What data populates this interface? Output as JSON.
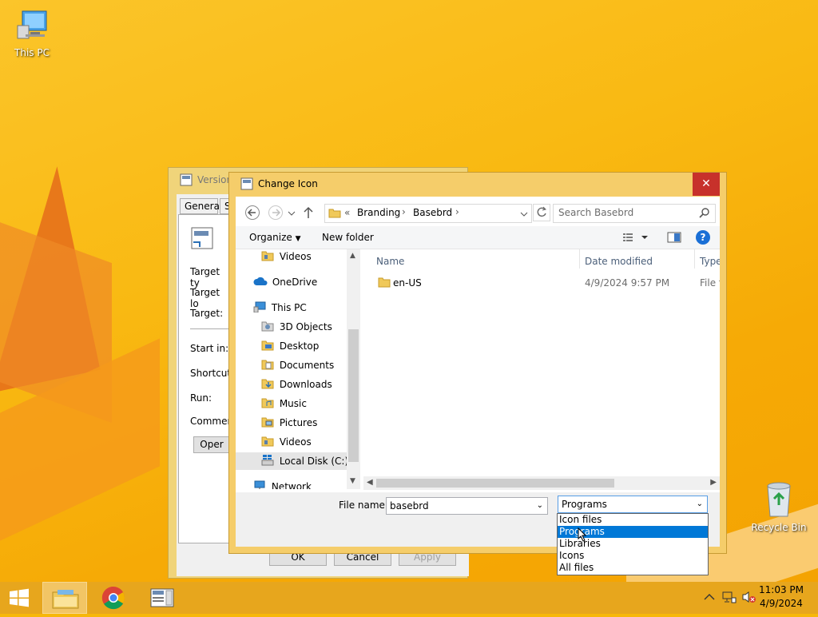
{
  "desktop": {
    "icons": [
      {
        "label": "This PC"
      },
      {
        "label": "Recycle Bin"
      }
    ]
  },
  "properties_window": {
    "title": "Version",
    "tabs": [
      "General",
      "S"
    ],
    "fields": [
      "Target ty",
      "Target lo",
      "Target:",
      "Start in:",
      "Shortcut",
      "Run:",
      "Commen"
    ],
    "open_button": "Oper",
    "ok": "OK",
    "cancel": "Cancel",
    "apply": "Apply"
  },
  "dialog": {
    "title": "Change Icon",
    "close_glyph": "✕",
    "breadcrumb": {
      "prefix": "«",
      "parts": [
        "Branding",
        "Basebrd"
      ]
    },
    "search_placeholder": "Search Basebrd",
    "toolbar": {
      "organize": "Organize",
      "new_folder": "New folder",
      "help": "?"
    },
    "nav_items": [
      {
        "label": "Videos",
        "icon": "video-folder"
      },
      {
        "label": "OneDrive",
        "icon": "cloud"
      },
      {
        "label": "This PC",
        "icon": "computer"
      },
      {
        "label": "3D Objects",
        "icon": "3d-folder"
      },
      {
        "label": "Desktop",
        "icon": "desktop-folder"
      },
      {
        "label": "Documents",
        "icon": "documents-folder"
      },
      {
        "label": "Downloads",
        "icon": "downloads-folder"
      },
      {
        "label": "Music",
        "icon": "music-folder"
      },
      {
        "label": "Pictures",
        "icon": "pictures-folder"
      },
      {
        "label": "Videos",
        "icon": "video-folder"
      },
      {
        "label": "Local Disk (C:)",
        "icon": "drive"
      },
      {
        "label": "Network",
        "icon": "network"
      }
    ],
    "columns": {
      "name": "Name",
      "date": "Date modified",
      "type": "Type"
    },
    "files": [
      {
        "name": "en-US",
        "date": "4/9/2024 9:57 PM",
        "type": "File fo"
      }
    ],
    "file_name_label": "File name:",
    "file_name_value": "basebrd",
    "file_type_value": "Programs",
    "file_type_options": [
      "Icon files",
      "Programs",
      "Libraries",
      "Icons",
      "All files"
    ],
    "selected_option": "Programs"
  },
  "taskbar": {
    "time": "11:03 PM",
    "date": "4/9/2024"
  },
  "colors": {
    "accent_close": "#c7312b",
    "selection": "#0078d7",
    "dialog_frame": "#f5cd6a",
    "taskbar": "#e7a61d"
  }
}
